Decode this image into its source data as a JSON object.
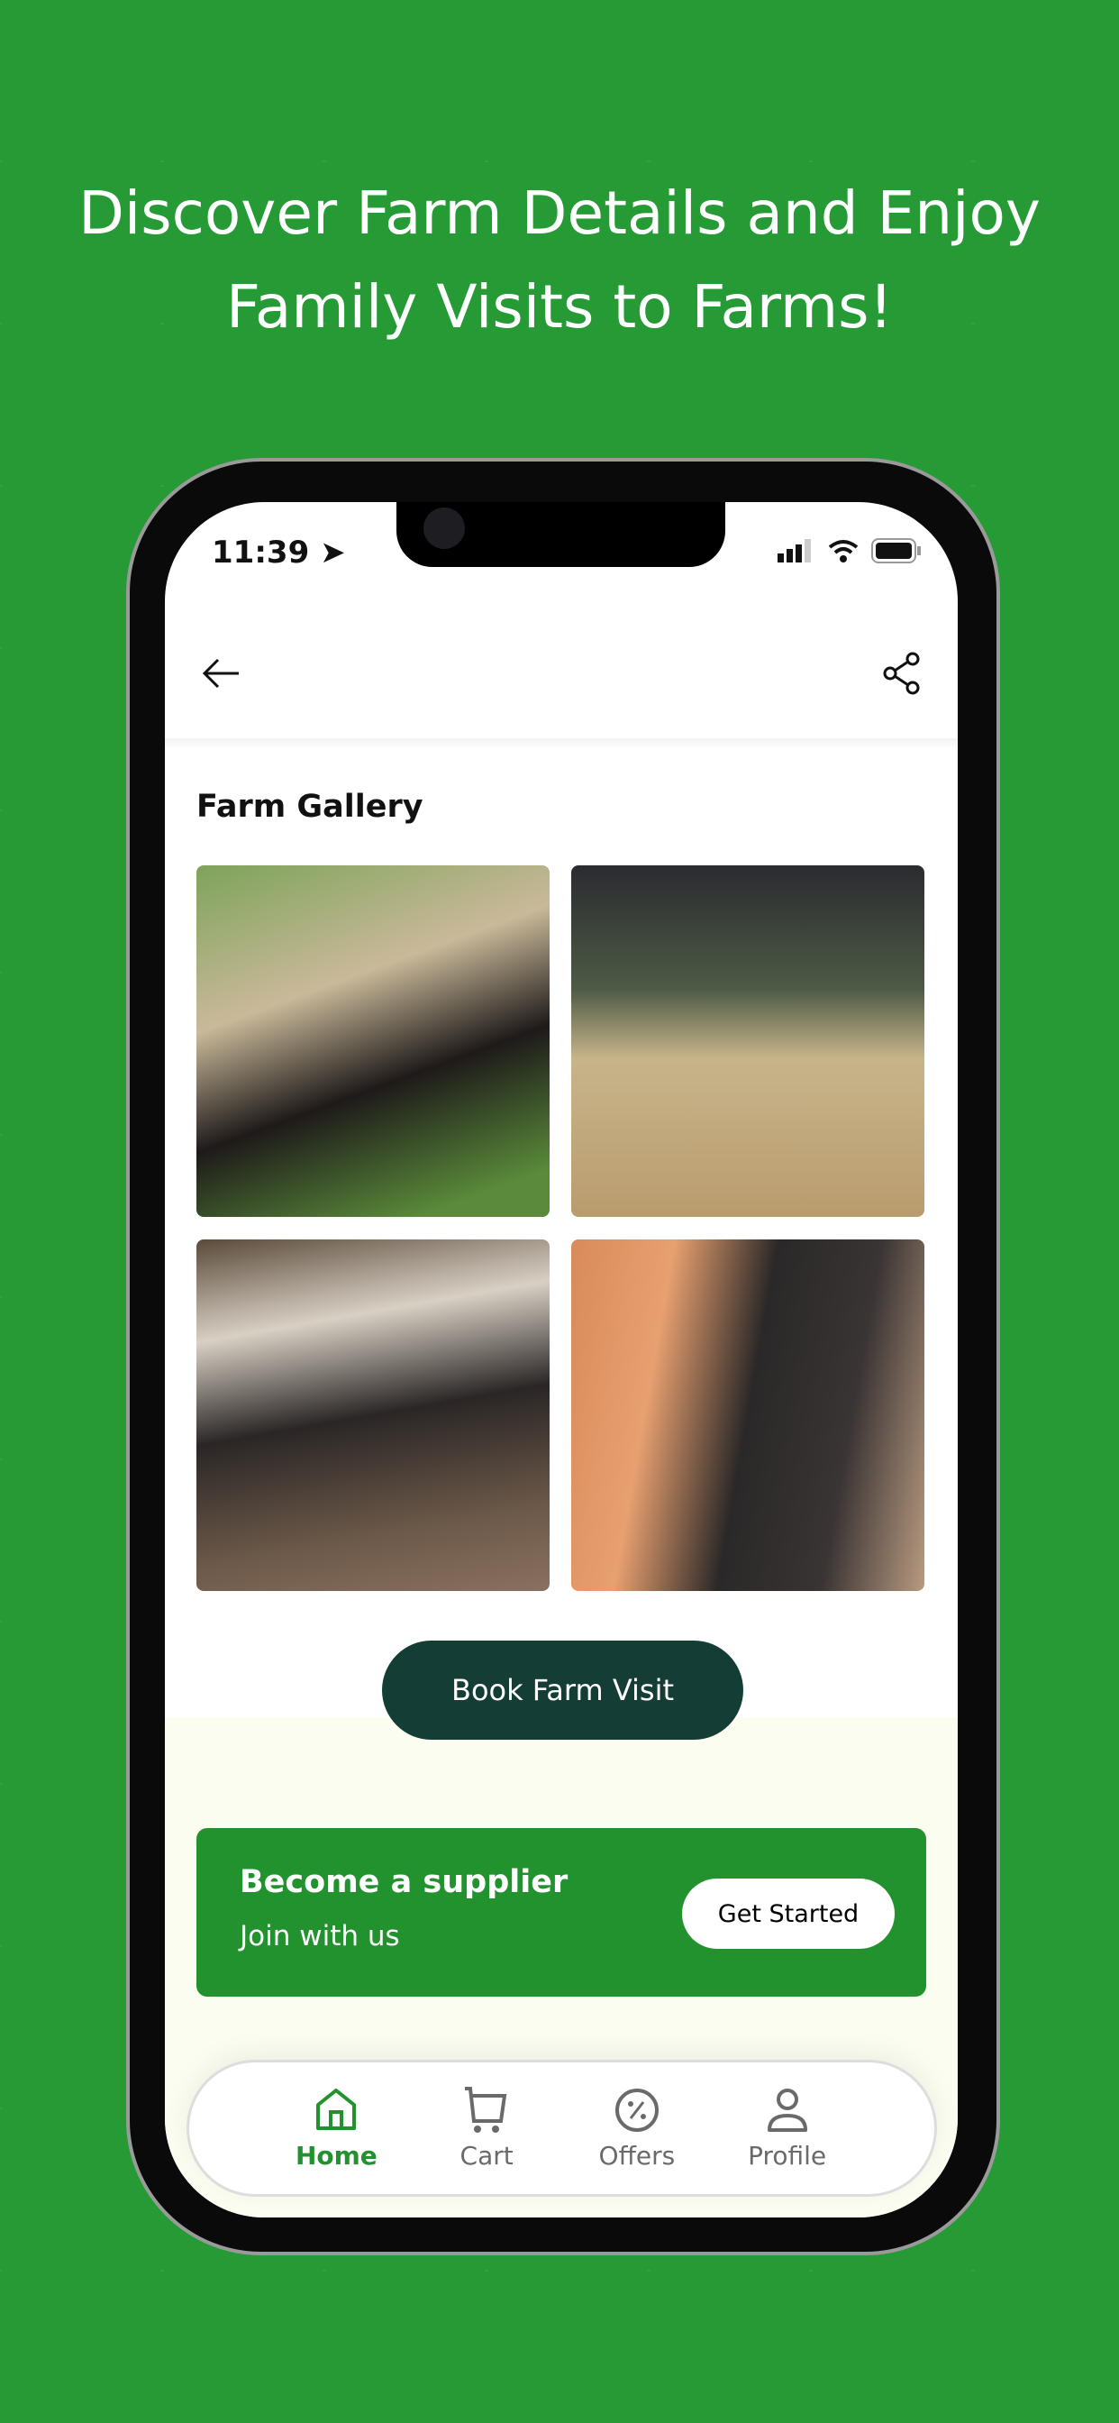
{
  "headline": {
    "line1": "Discover Farm Details and Enjoy",
    "line2": "Family Visits to Farms!"
  },
  "status_bar": {
    "time": "11:39"
  },
  "gallery": {
    "title": "Farm Gallery",
    "images": [
      "woman-feeding-buffalo",
      "cattle-shed-with-hay",
      "buffalo-shed-cleaning",
      "man-feeding-buffalo"
    ]
  },
  "book_button": "Book Farm Visit",
  "supplier": {
    "title": "Become a supplier",
    "subtitle": "Join with us",
    "button": "Get Started"
  },
  "nav": [
    {
      "label": "Home",
      "icon": "home-icon",
      "active": true
    },
    {
      "label": "Cart",
      "icon": "cart-icon"
    },
    {
      "label": "Offers",
      "icon": "offers-icon"
    },
    {
      "label": "Profile",
      "icon": "profile-icon"
    }
  ],
  "colors": {
    "background": "#259a35",
    "accent": "#22922f",
    "book_button": "#143d35",
    "cream": "#fbfdf0"
  }
}
